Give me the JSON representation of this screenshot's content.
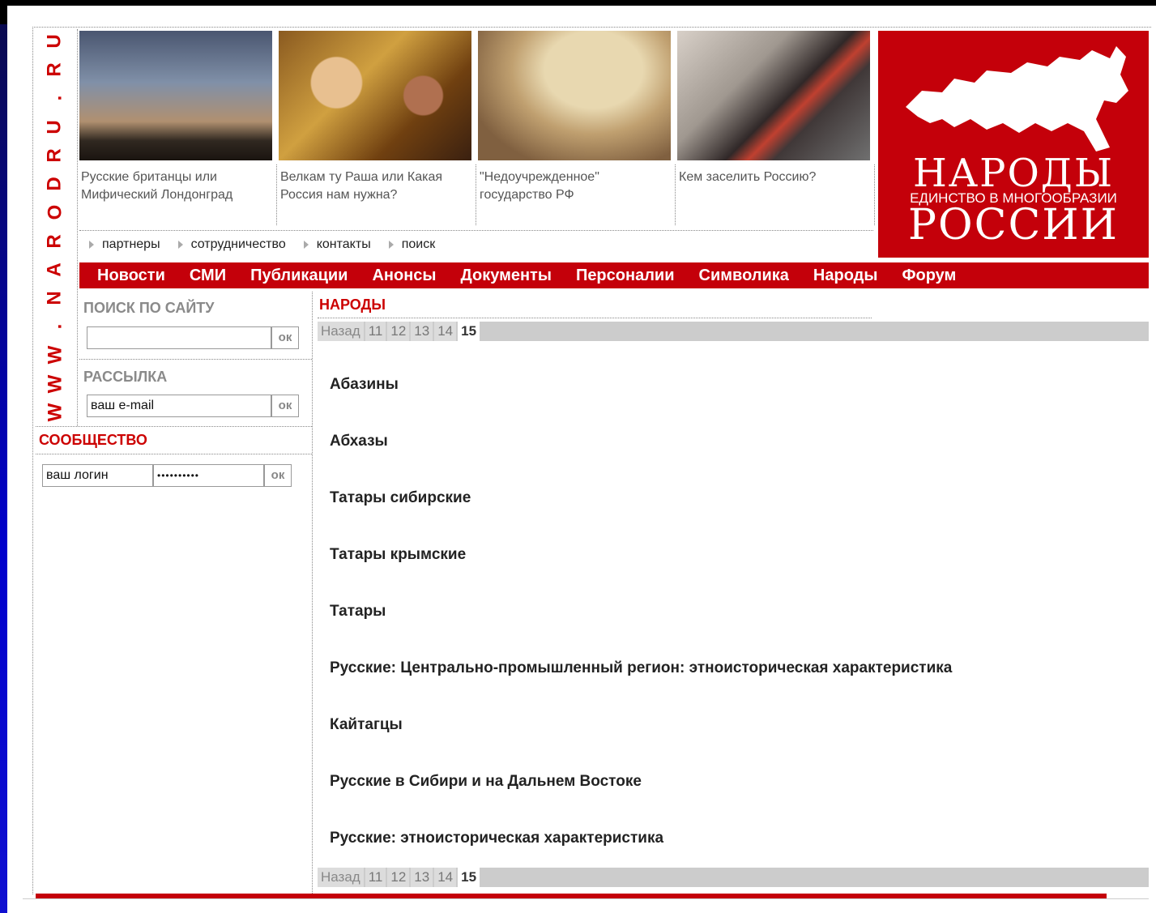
{
  "site": {
    "vertical_url": [
      "W",
      "W",
      "W",
      ".",
      "N",
      "A",
      "R",
      "O",
      "D",
      "R",
      "U",
      ".",
      "R",
      "U"
    ]
  },
  "teasers": [
    {
      "caption": "Русские британцы или Мифический Лондонград",
      "image": "london-photo"
    },
    {
      "caption": "Велкам ту Раша или Какая Россия нам нужна?",
      "image": "kokoshnik-photo"
    },
    {
      "caption": "\"Недоучрежденное\" государство РФ",
      "image": "globe-photo"
    },
    {
      "caption": "Кем заселить Россию?",
      "image": "poster-photo"
    }
  ],
  "logo": {
    "line1": "НАРОДЫ",
    "line2": "ЕДИНСТВО В МНОГООБРАЗИИ",
    "line3": "РОССИИ",
    "icon": "russia-map-icon",
    "color": "#c4000a"
  },
  "subnav": [
    "партнеры",
    "сотрудничество",
    "контакты",
    "поиск"
  ],
  "mainnav": [
    "Новости",
    "СМИ",
    "Публикации",
    "Анонсы",
    "Документы",
    "Персоналии",
    "Символика",
    "Народы",
    "Форум"
  ],
  "sidebar": {
    "search_title": "ПОИСК ПО САЙТУ",
    "search_value": "",
    "ok": "ок",
    "mailing_title": "РАССЫЛКА",
    "email_value": "ваш e-mail",
    "community_title": "СООБЩЕСТВО",
    "login_value": "ваш логин",
    "password_value": "••••••••••"
  },
  "content": {
    "title": "НАРОДЫ",
    "pager": {
      "back": "Назад",
      "pages": [
        "11",
        "12",
        "13",
        "14"
      ],
      "current": "15"
    },
    "items": [
      "Абазины",
      "Абхазы",
      "Татары сибирские",
      "Татары крымские",
      "Татары",
      "Русские: Центрально-промышленный регион: этноисторическая характеристика",
      "Кайтагцы",
      "Русские в Сибири и на Дальнем Востоке",
      "Русские: этноисторическая характеристика"
    ]
  }
}
